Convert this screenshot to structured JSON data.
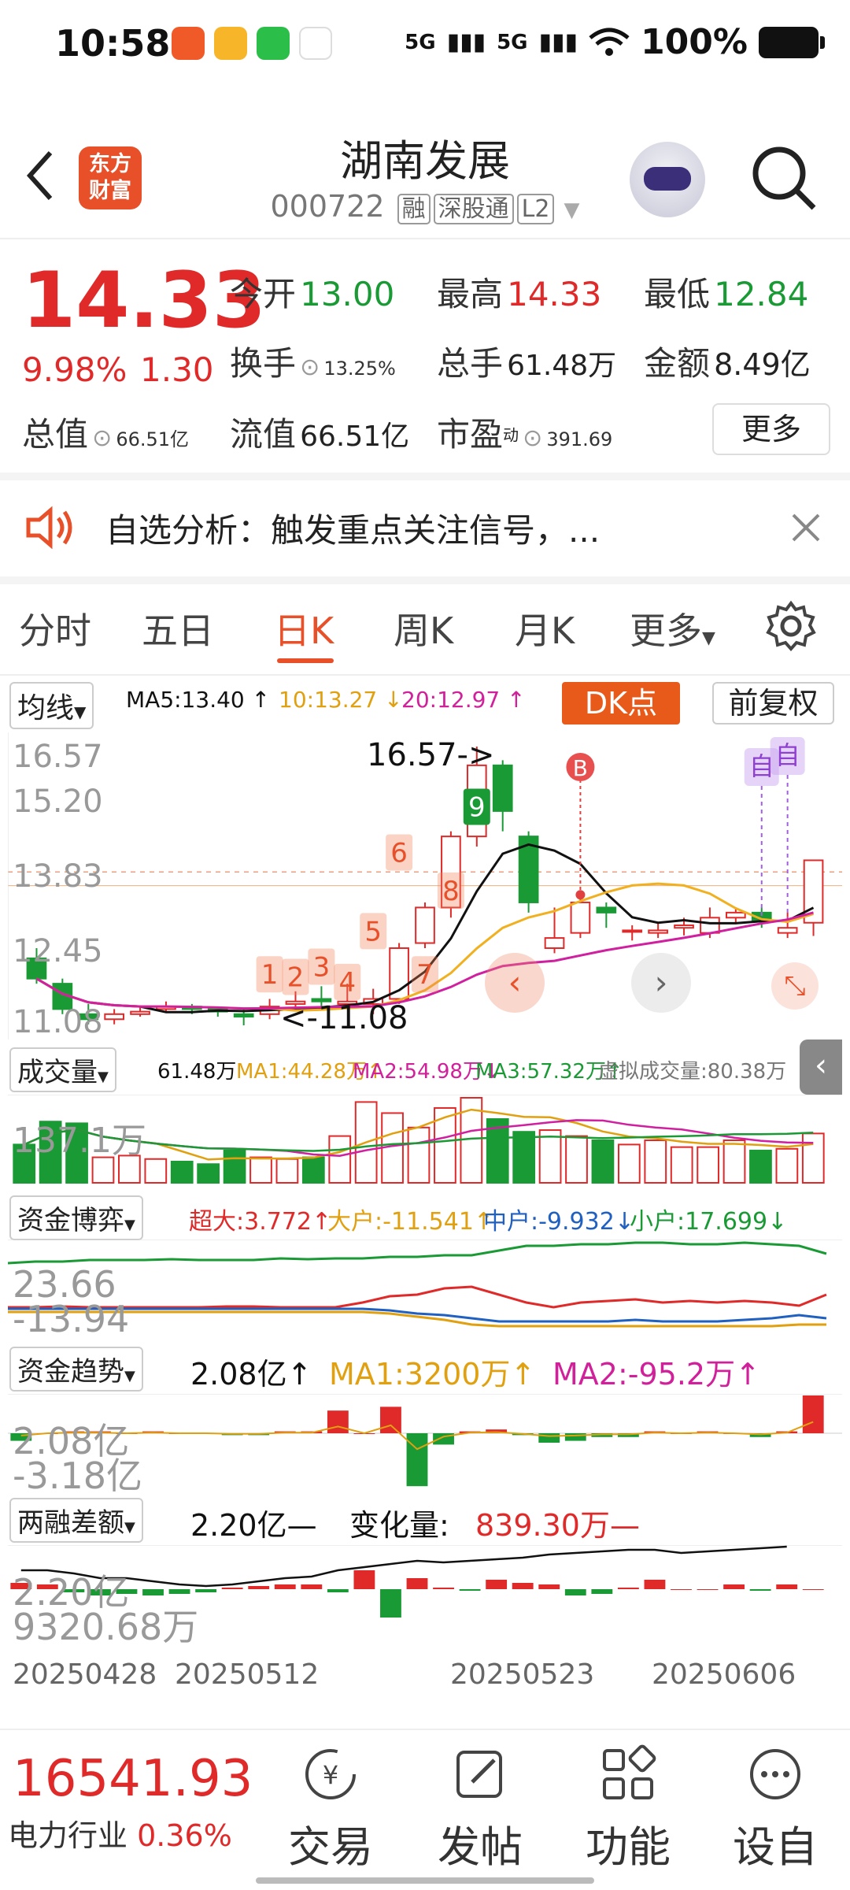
{
  "status_bar": {
    "time": "10:58",
    "signal1": "5G",
    "signal2": "5G",
    "battery": "100%"
  },
  "header": {
    "name": "湖南发展",
    "code": "000722",
    "tags": [
      "融",
      "深股通",
      "L2"
    ],
    "logo_text": [
      "东方",
      "财富"
    ]
  },
  "quote": {
    "price": "14.33",
    "change_pct": "9.98%",
    "change": "1.30",
    "open_label": "今开",
    "open": "13.00",
    "high_label": "最高",
    "high": "14.33",
    "low_label": "最低",
    "low": "12.84",
    "turnover_label": "换手",
    "turnover": "13.25%",
    "volume_label": "总手",
    "volume": "61.48万",
    "amount_label": "金额",
    "amount": "8.49亿",
    "mktcap_label": "总值",
    "mktcap": "66.51亿",
    "float_label": "流值",
    "float": "66.51亿",
    "pe_label": "市盈",
    "pe_sup": "动",
    "pe": "391.69",
    "more": "更多"
  },
  "notice": {
    "text": "自选分析：触发重点关注信号，..."
  },
  "tabs": [
    "分时",
    "五日",
    "日K",
    "周K",
    "月K",
    "更多"
  ],
  "ma_bar": {
    "selector": "均线",
    "ma5": "MA5:13.40 ↑",
    "ma10": "10:13.27 ↓",
    "ma20": "20:12.97 ↑",
    "dk": "DK点",
    "adjust": "前复权"
  },
  "kline": {
    "y_labels": [
      "16.57",
      "15.20",
      "13.83",
      "12.45",
      "11.08"
    ],
    "high_note": "16.57->",
    "low_note": "<-11.08",
    "markers": [
      "1",
      "2",
      "3",
      "4",
      "5",
      "6",
      "7",
      "8",
      "9"
    ],
    "b_marker": "B",
    "self_markers": [
      "自",
      "自"
    ],
    "colors": {
      "up": "#e02a2a",
      "down": "#1a9a35",
      "ma5": "#111111",
      "ma10": "#f0b020",
      "ma20": "#d020a0"
    }
  },
  "chart_data": {
    "type": "candlestick",
    "x": [
      "20250428",
      "",
      "",
      "",
      "",
      "",
      "",
      "",
      "20250512",
      "",
      "",
      "",
      "",
      "",
      "",
      "",
      "",
      "",
      "",
      "20250523",
      "",
      "",
      "",
      "",
      "",
      "",
      "",
      "",
      "",
      "20250606",
      "",
      ""
    ],
    "candles": [
      [
        12.4,
        12.0,
        12.6,
        11.9
      ],
      [
        11.9,
        11.4,
        12.0,
        11.3
      ],
      [
        11.3,
        11.2,
        11.5,
        11.1
      ],
      [
        11.2,
        11.3,
        11.4,
        11.1
      ],
      [
        11.3,
        11.35,
        11.45,
        11.25
      ],
      [
        11.4,
        11.45,
        11.55,
        11.35
      ],
      [
        11.45,
        11.4,
        11.5,
        11.3
      ],
      [
        11.4,
        11.35,
        11.45,
        11.25
      ],
      [
        11.3,
        11.25,
        11.4,
        11.08
      ],
      [
        11.3,
        11.45,
        11.6,
        11.2
      ],
      [
        11.5,
        11.55,
        11.75,
        11.4
      ],
      [
        11.6,
        11.55,
        11.85,
        11.45
      ],
      [
        11.5,
        11.55,
        11.9,
        11.4
      ],
      [
        11.5,
        11.6,
        11.8,
        11.3
      ],
      [
        11.6,
        12.6,
        12.7,
        11.5
      ],
      [
        12.7,
        13.4,
        13.5,
        12.6
      ],
      [
        13.4,
        14.8,
        14.9,
        13.2
      ],
      [
        14.8,
        16.2,
        16.57,
        14.6
      ],
      [
        16.2,
        15.3,
        16.3,
        14.9
      ],
      [
        14.8,
        13.5,
        14.9,
        13.3
      ],
      [
        12.6,
        12.8,
        13.4,
        12.5
      ],
      [
        12.9,
        13.5,
        13.6,
        12.8
      ],
      [
        13.4,
        13.3,
        13.5,
        13.0
      ],
      [
        12.95,
        12.95,
        13.05,
        12.75
      ],
      [
        12.9,
        12.95,
        13.1,
        12.8
      ],
      [
        13.0,
        13.05,
        13.2,
        12.85
      ],
      [
        12.9,
        13.2,
        13.4,
        12.8
      ],
      [
        13.2,
        13.3,
        13.4,
        13.1
      ],
      [
        13.3,
        13.15,
        13.4,
        13.0
      ],
      [
        12.9,
        13.0,
        13.3,
        12.8
      ],
      [
        13.1,
        14.33,
        14.33,
        12.84
      ]
    ],
    "ma_values": {
      "MA5": "13.40",
      "MA10": "13.27",
      "MA20": "12.97"
    },
    "ylim": [
      11.08,
      16.57
    ]
  },
  "volume": {
    "selector": "成交量",
    "vol": "61.48万",
    "ma1": "MA1:44.28万↑",
    "ma2": "MA2:54.98万↓",
    "ma3": "MA3:57.32万↑",
    "virtual": "虚拟成交量:80.38万",
    "max_label": "137.1万"
  },
  "fund_game": {
    "selector": "资金博弈",
    "super": "超大:3.772↑",
    "large": "大户:-11.541↑",
    "mid": "中户:-9.932↓",
    "small": "小户:17.699↓",
    "top": "23.66",
    "bottom": "-13.94"
  },
  "fund_trend": {
    "selector": "资金趋势",
    "value": "2.08亿↑",
    "ma1": "MA1:3200万↑",
    "ma2": "MA2:-95.2万↑",
    "top": "2.08亿",
    "bottom": "-3.18亿"
  },
  "margin": {
    "selector": "两融差额",
    "value": "2.20亿—",
    "change_label": "变化量:",
    "change": "839.30万—",
    "top": "2.20亿",
    "bottom": "9320.68万"
  },
  "dates": [
    "20250428",
    "20250512",
    "20250523",
    "20250606"
  ],
  "bottom_nav": {
    "index_value": "16541.93",
    "index_name": "电力行业",
    "index_change": "0.36%",
    "items": [
      "交易",
      "发帖",
      "功能",
      "设自"
    ]
  }
}
